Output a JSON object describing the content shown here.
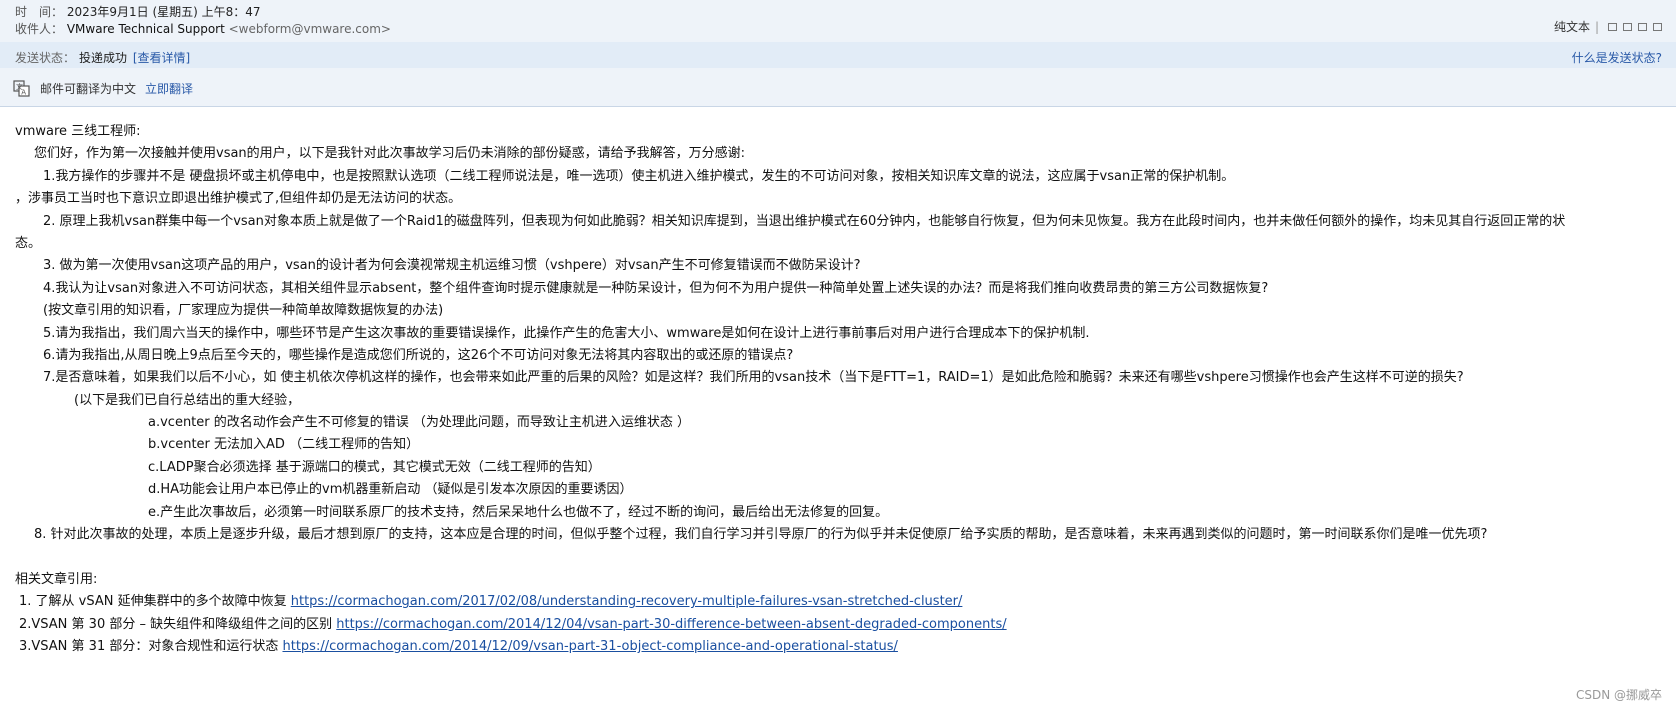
{
  "header": {
    "time_label": "时　间：",
    "time_value": "2023年9月1日 (星期五) 上午8：47",
    "recipient_label": "收件人：",
    "recipient_name": "VMware Technical Support",
    "recipient_addr": "<webform@vmware.com>",
    "plain_text_link": "纯文本",
    "separator": "|"
  },
  "status": {
    "label": "发送状态：",
    "value": "投递成功",
    "detail_link": "[查看详情]",
    "help_link": "什么是发送状态?"
  },
  "translate": {
    "icon": "translate-icon",
    "message": "邮件可翻译为中文",
    "link": "立即翻译"
  },
  "body": {
    "lines": [
      "vmware 三线工程师:",
      "您们好，作为第一次接触并使用vsan的用户，以下是我针对此次事故学习后仍未消除的部份疑惑，请给予我解答，万分感谢:",
      "1.我方操作的步骤并不是 硬盘损坏或主机停电中，也是按照默认选项（二线工程师说法是，唯一选项）使主机进入维护模式，发生的不可访问对象，按相关知识库文章的说法，这应属于vsan正常的保护机制。",
      "，涉事员工当时也下意识立即退出维护模式了,但组件却仍是无法访问的状态。",
      "2. 原理上我机vsan群集中每一个vsan对象本质上就是做了一个Raid1的磁盘阵列，但表现为何如此脆弱？相关知识库提到，当退出维护模式在60分钟内，也能够自行恢复，但为何未见恢复。我方在此段时间内，也并未做任何额外的操作，均未见其自行返回正常的状",
      "态。",
      "3. 做为第一次使用vsan这项产品的用户，vsan的设计者为何会漠视常规主机运维习惯（vshpere）对vsan产生不可修复错误而不做防呆设计?",
      "4.我认为让vsan对象进入不可访问状态，其相关组件显示absent，整个组件查询时提示健康就是一种防呆设计，但为何不为用户提供一种简单处置上述失误的办法？而是将我们推向收费昂贵的第三方公司数据恢复?",
      "(按文章引用的知识看，厂家理应为提供一种简单故障数据恢复的办法)",
      "5.请为我指出，我们周六当天的操作中，哪些环节是产生这次事故的重要错误操作，此操作产生的危害大小、wmware是如何在设计上进行事前事后对用户进行合理成本下的保护机制.",
      "6.请为我指出,从周日晚上9点后至今天的，哪些操作是造成您们所说的，这26个不可访问对象无法将其内容取出的或还原的错误点?",
      "7.是否意味着，如果我们以后不小心，如 使主机依次停机这样的操作，也会带来如此严重的后果的风险？如是这样？我们所用的vsan技术（当下是FTT=1，RAID=1）是如此危险和脆弱？未来还有哪些vshpere习惯操作也会产生这样不可逆的损失?",
      "(以下是我们已自行总结出的重大经验，",
      "a.vcenter 的改名动作会产生不可修复的错误 （为处理此问题，而导致让主机进入运维状态 ）",
      "b.vcenter 无法加入AD （二线工程师的告知）",
      "c.LADP聚合必须选择 基于源端口的模式，其它模式无效（二线工程师的告知）",
      "d.HA功能会让用户本已停止的vm机器重新启动 （疑似是引发本次原因的重要诱因）",
      "e.产生此次事故后，必须第一时间联系原厂的技术支持，然后呆呆地什么也做不了，经过不断的询问，最后给出无法修复的回复。",
      "8. 针对此次事故的处理，本质上是逐步升级，最后才想到原厂的支持，这本应是合理的时间，但似乎整个过程，我们自行学习并引导原厂的行为似乎并未促使原厂给予实质的帮助，是否意味着，未来再遇到类似的问题时，第一时间联系你们是唯一优先项?"
    ],
    "refs_heading": "相关文章引用:",
    "refs": [
      {
        "prefix": "1.  了解从 vSAN 延伸集群中的多个故障中恢复 ",
        "url": "https://cormachogan.com/2017/02/08/understanding-recovery-multiple-failures-vsan-stretched-cluster/"
      },
      {
        "prefix": "2.VSAN 第 30 部分 – 缺失组件和降级组件之间的区别  ",
        "url": "https://cormachogan.com/2014/12/04/vsan-part-30-difference-between-absent-degraded-components/"
      },
      {
        "prefix": "3.VSAN 第 31 部分：对象合规性和运行状态 ",
        "url": "https://cormachogan.com/2014/12/09/vsan-part-31-object-compliance-and-operational-status/"
      }
    ]
  },
  "watermark": "CSDN @挪威卒"
}
